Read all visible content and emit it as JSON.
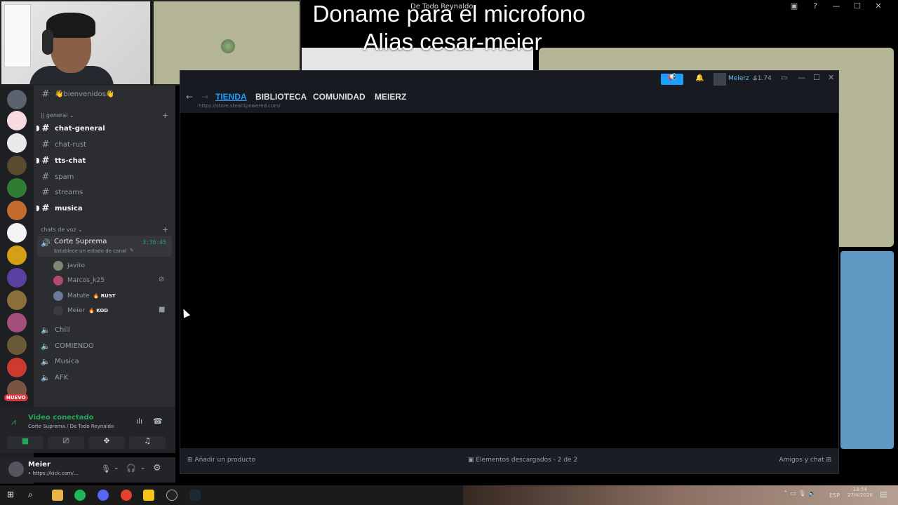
{
  "overlay": {
    "line1": "Doname para el microfono",
    "line2": "Alias cesar-meier"
  },
  "obs_window_title": "De Todo Reynaldo",
  "discord": {
    "top_channel": "👋bienvenidos👋",
    "category_general": "|| general",
    "text_channels": [
      {
        "name": "chat-general",
        "unread": true
      },
      {
        "name": "chat-rust",
        "unread": false
      },
      {
        "name": "tts-chat",
        "unread": true
      },
      {
        "name": "spam",
        "unread": false
      },
      {
        "name": "streams",
        "unread": false
      },
      {
        "name": "musica",
        "unread": true
      }
    ],
    "category_voice": "chats de voz",
    "active_voice": {
      "name": "Corte Suprema",
      "timer": "3:36:45",
      "status_placeholder": "Establece un estado de canal"
    },
    "voice_users": [
      {
        "name": "Javito",
        "badge": ""
      },
      {
        "name": "Marcos_k25",
        "badge": ""
      },
      {
        "name": "Matute",
        "badge": "RUST"
      },
      {
        "name": "Meier",
        "badge": "KOD"
      }
    ],
    "voice_channels": [
      "Chill",
      "COMIENDO",
      "Musica",
      "AFK"
    ],
    "new_badge": "NUEVO",
    "connection": {
      "status": "Video conectado",
      "location": "Corte Suprema / De Todo Reynaldo"
    },
    "user": {
      "name": "Meier",
      "status": "• https://kick.com/..."
    }
  },
  "steam": {
    "nav": [
      "TIENDA",
      "BIBLIOTECA",
      "COMUNIDAD",
      "MEIERZ"
    ],
    "active_nav": "TIENDA",
    "url": "https://store.steampowered.com/",
    "account_name": "Meierz",
    "balance": "$1.74",
    "bottom_add": "Añadir un producto",
    "bottom_downloads": "Elementos descargados - 2 de 2",
    "bottom_friends": "Amigos y chat",
    "colors": {
      "accent": "#1a9fff",
      "bg": "#171a21"
    }
  },
  "taskbar": {
    "lang": "ESP",
    "time": "18:54",
    "date": "27/4/2026"
  }
}
